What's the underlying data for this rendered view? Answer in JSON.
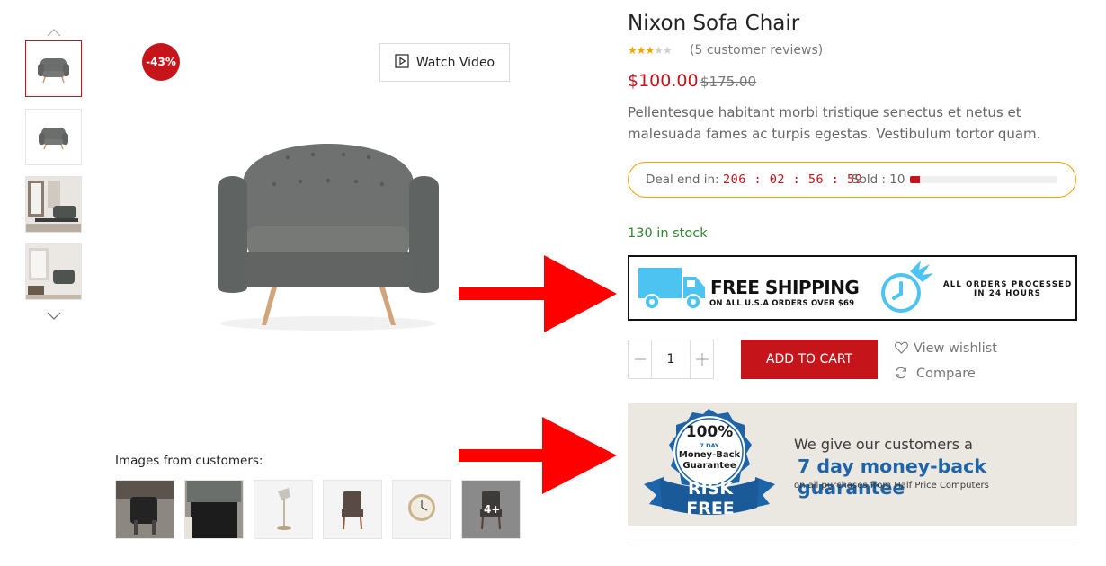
{
  "gallery": {
    "discount_badge": "-43%",
    "watch_video_label": "Watch Video",
    "customers_label": "Images from customers:",
    "more_images_label": "4+"
  },
  "product": {
    "title": "Nixon Sofa Chair",
    "rating": 3,
    "rating_max": 5,
    "reviews_label": "(5 customer reviews)",
    "price": "$100.00",
    "old_price": "$175.00",
    "description": "Pellentesque habitant morbi tristique senectus et netus et malesuada fames ac turpis egestas. Vestibulum tortor quam.",
    "deal_label": "Deal end in:",
    "deal_timer": "206 : 02 : 56 : 59",
    "sold_label": "Sold : 10",
    "sold_progress": 0.07,
    "stock_label": "130 in stock"
  },
  "shipping_banner": {
    "headline": "FREE SHIPPING",
    "subline": "ON ALL U.S.A ORDERS OVER $69",
    "processed_line1": "ALL ORDERS PROCESSED",
    "processed_line2": "IN 24 HOURS"
  },
  "purchase": {
    "quantity": "1",
    "add_to_cart_label": "ADD TO CART",
    "wishlist_label": "View wishlist",
    "compare_label": "Compare"
  },
  "guarantee_banner": {
    "seal_percent": "100%",
    "seal_days": "7 DAY",
    "seal_line1": "Money-Back",
    "seal_line2": "Guarantee",
    "ribbon": "RISK FREE",
    "line1": "We give our customers a",
    "line2": "7 day money-back guarantee",
    "line3": "on all purchases from Half Price Computers"
  },
  "colors": {
    "accent_red": "#c5151b",
    "stock_green": "#2e8b2e",
    "deal_border": "#f0a500",
    "truck_blue": "#4dc3f2",
    "guarantee_blue": "#1e64a8"
  }
}
